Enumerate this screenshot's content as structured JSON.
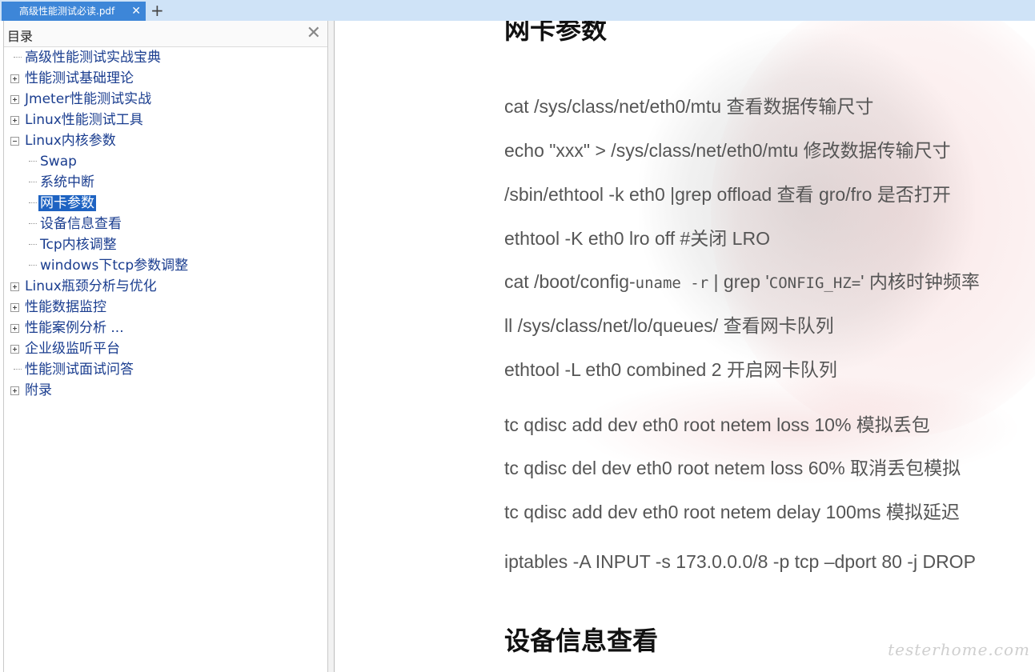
{
  "tab": {
    "title": "高级性能测试必读.pdf",
    "close_glyph": "✕",
    "add_glyph": "+"
  },
  "sidebar": {
    "title": "目录",
    "close_glyph": "✕",
    "items": [
      {
        "label": "高级性能测试实战宝典",
        "expander": "none"
      },
      {
        "label": "性能测试基础理论",
        "expander": "plus"
      },
      {
        "label": "Jmeter性能测试实战",
        "expander": "plus"
      },
      {
        "label": "Linux性能测试工具",
        "expander": "plus"
      },
      {
        "label": "Linux内核参数",
        "expander": "minus"
      },
      {
        "label": "Swap",
        "expander": "none"
      },
      {
        "label": "系统中断",
        "expander": "none"
      },
      {
        "label": "网卡参数",
        "expander": "none",
        "selected": true
      },
      {
        "label": "设备信息查看",
        "expander": "none"
      },
      {
        "label": "Tcp内核调整",
        "expander": "none"
      },
      {
        "label": "windows下tcp参数调整",
        "expander": "none"
      },
      {
        "label": "Linux瓶颈分析与优化",
        "expander": "plus"
      },
      {
        "label": "性能数据监控",
        "expander": "plus"
      },
      {
        "label": "性能案例分析 ...",
        "expander": "plus"
      },
      {
        "label": "企业级监听平台",
        "expander": "plus"
      },
      {
        "label": "性能测试面试问答",
        "expander": "none"
      },
      {
        "label": "附录",
        "expander": "plus"
      }
    ]
  },
  "document": {
    "heading1": "网卡参数",
    "lines": [
      "cat /sys/class/net/eth0/mtu  查看数据传输尺寸",
      "echo \"xxx\" > /sys/class/net/eth0/mtu  修改数据传输尺寸",
      "/sbin/ethtool -k eth0 |grep offload  查看 gro/fro 是否打开",
      "ethtool -K eth0 lro off #关闭 LRO",
      "ll /sys/class/net/lo/queues/  查看网卡队列",
      "ethtool -L eth0 combined 2  开启网卡队列",
      "tc qdisc add dev eth0 root netem loss 10%  模拟丢包",
      "tc qdisc del dev eth0 root netem loss 60%  取消丢包模拟",
      "tc qdisc add dev eth0 root netem delay 100ms  模拟延迟",
      "iptables -A INPUT -s 173.0.0.0/8 -p tcp –dport 80 -j DROP"
    ],
    "config_line": {
      "prefix": "cat /boot/config-",
      "code1": "uname -r",
      "middle": " | grep '",
      "code2": "CONFIG_HZ=",
      "suffix": "' 内核时钟频率"
    },
    "heading2": "设备信息查看",
    "watermark": "testerhome.com"
  }
}
